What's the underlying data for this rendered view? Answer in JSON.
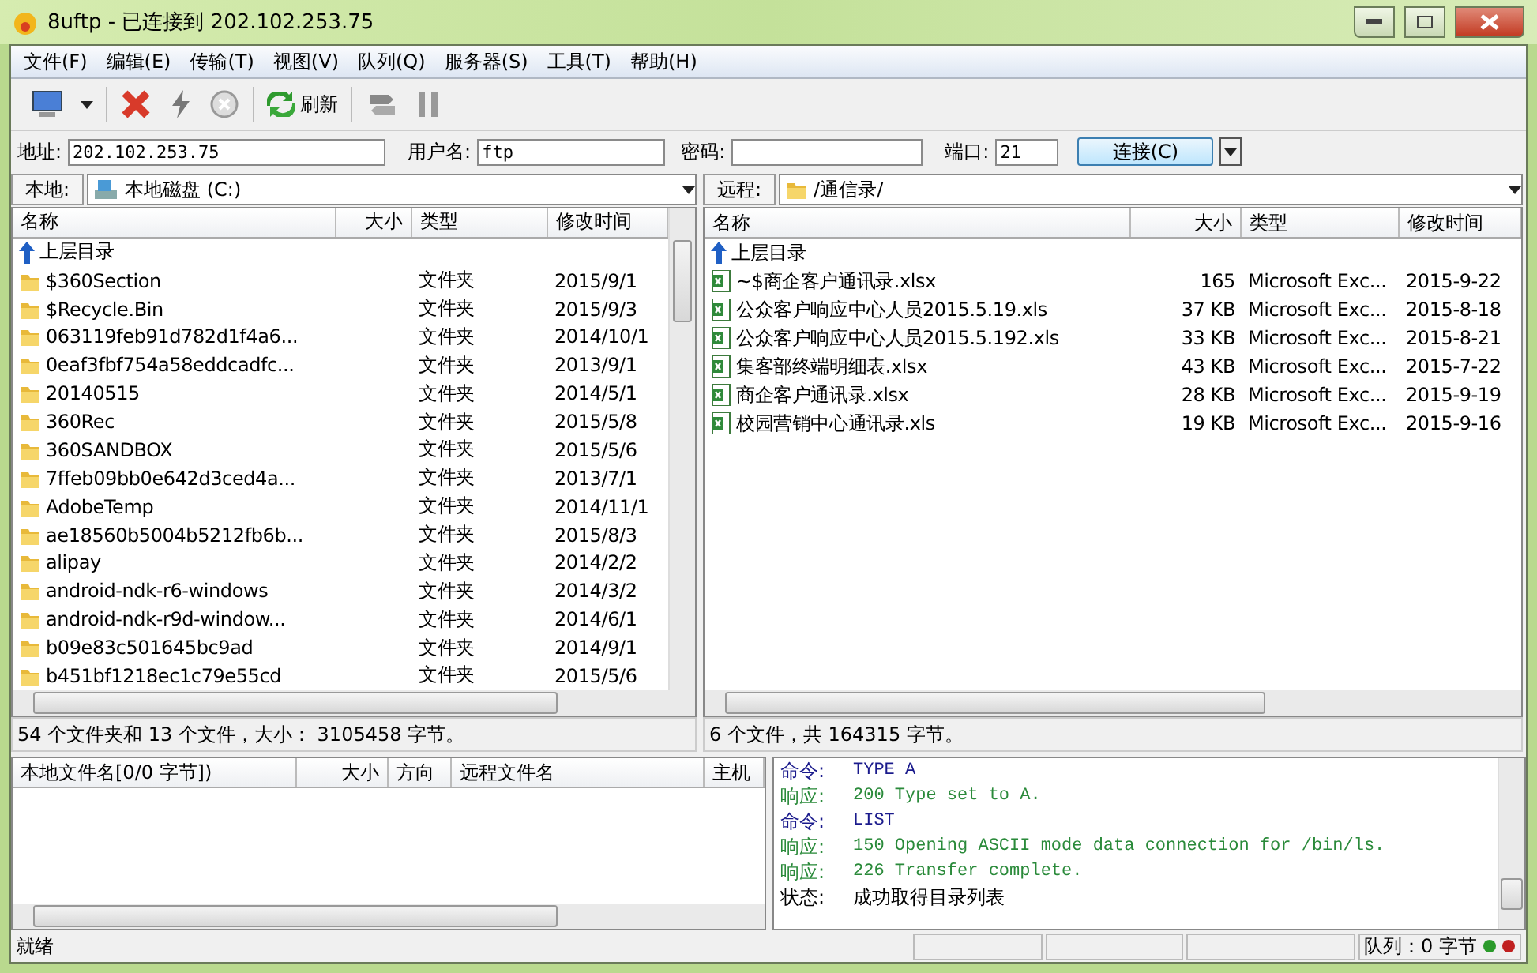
{
  "window": {
    "title": "8uftp - 已连接到 202.102.253.75"
  },
  "menu": [
    "文件(F)",
    "编辑(E)",
    "传输(T)",
    "视图(V)",
    "队列(Q)",
    "服务器(S)",
    "工具(T)",
    "帮助(H)"
  ],
  "toolbar": {
    "refresh_label": "刷新"
  },
  "connection": {
    "address_label": "地址:",
    "address": "202.102.253.75",
    "user_label": "用户名:",
    "user": "ftp",
    "password_label": "密码:",
    "port_label": "端口:",
    "port": "21",
    "connect_label": "连接(C)"
  },
  "local": {
    "label": "本地:",
    "path": "本地磁盘  (C:)",
    "columns": [
      "名称",
      "大小",
      "类型",
      "修改时间"
    ],
    "parent": "上层目录",
    "rows": [
      {
        "name": "$360Section",
        "type": "文件夹",
        "modified": "2015/9/1"
      },
      {
        "name": "$Recycle.Bin",
        "type": "文件夹",
        "modified": "2015/9/3"
      },
      {
        "name": "063119feb91d782d1f4a6...",
        "type": "文件夹",
        "modified": "2014/10/1"
      },
      {
        "name": "0eaf3fbf754a58eddcadfc...",
        "type": "文件夹",
        "modified": "2013/9/1"
      },
      {
        "name": "20140515",
        "type": "文件夹",
        "modified": "2014/5/1"
      },
      {
        "name": "360Rec",
        "type": "文件夹",
        "modified": "2015/5/8"
      },
      {
        "name": "360SANDBOX",
        "type": "文件夹",
        "modified": "2015/5/6"
      },
      {
        "name": "7ffeb09bb0e642d3ced4a...",
        "type": "文件夹",
        "modified": "2013/7/1"
      },
      {
        "name": "AdobeTemp",
        "type": "文件夹",
        "modified": "2014/11/1"
      },
      {
        "name": "ae18560b5004b5212fb6b...",
        "type": "文件夹",
        "modified": "2015/8/3"
      },
      {
        "name": "alipay",
        "type": "文件夹",
        "modified": "2014/2/2"
      },
      {
        "name": "android-ndk-r6-windows",
        "type": "文件夹",
        "modified": "2014/3/2"
      },
      {
        "name": "android-ndk-r9d-window...",
        "type": "文件夹",
        "modified": "2014/6/1"
      },
      {
        "name": "b09e83c501645bc9ad",
        "type": "文件夹",
        "modified": "2014/9/1"
      },
      {
        "name": "b451bf1218ec1c79e55cd",
        "type": "文件夹",
        "modified": "2015/5/6"
      }
    ],
    "summary": "54 个文件夹和 13 个文件，大小： 3105458 字节。"
  },
  "remote": {
    "label": "远程:",
    "path": "/通信录/",
    "columns": [
      "名称",
      "大小",
      "类型",
      "修改时间"
    ],
    "parent": "上层目录",
    "rows": [
      {
        "name": "~$商企客户通讯录.xlsx",
        "size": "165",
        "type": "Microsoft Exc...",
        "modified": "2015-9-22"
      },
      {
        "name": "公众客户响应中心人员2015.5.19.xls",
        "size": "37 KB",
        "type": "Microsoft Exc...",
        "modified": "2015-8-18"
      },
      {
        "name": "公众客户响应中心人员2015.5.192.xls",
        "size": "33 KB",
        "type": "Microsoft Exc...",
        "modified": "2015-8-21"
      },
      {
        "name": "集客部终端明细表.xlsx",
        "size": "43 KB",
        "type": "Microsoft Exc...",
        "modified": "2015-7-22"
      },
      {
        "name": "商企客户通讯录.xlsx",
        "size": "28 KB",
        "type": "Microsoft Exc...",
        "modified": "2015-9-19"
      },
      {
        "name": "校园营销中心通讯录.xls",
        "size": "19 KB",
        "type": "Microsoft Exc...",
        "modified": "2015-9-16"
      }
    ],
    "summary": "6 个文件，共 164315 字节。"
  },
  "queue": {
    "columns": [
      "本地文件名[0/0 字节])",
      "大小",
      "方向",
      "远程文件名",
      "主机"
    ]
  },
  "log": [
    {
      "kind": "command",
      "label": "命令:",
      "text": "TYPE A"
    },
    {
      "kind": "response",
      "label": "响应:",
      "text": "200 Type set to A."
    },
    {
      "kind": "command",
      "label": "命令:",
      "text": "LIST"
    },
    {
      "kind": "response",
      "label": "响应:",
      "text": "150 Opening ASCII mode data connection for /bin/ls."
    },
    {
      "kind": "response",
      "label": "响应:",
      "text": "226 Transfer complete."
    },
    {
      "kind": "status",
      "label": "状态:",
      "text": "成功取得目录列表"
    }
  ],
  "status_bar": {
    "text": "就绪",
    "queue": "队列：0 字节"
  }
}
